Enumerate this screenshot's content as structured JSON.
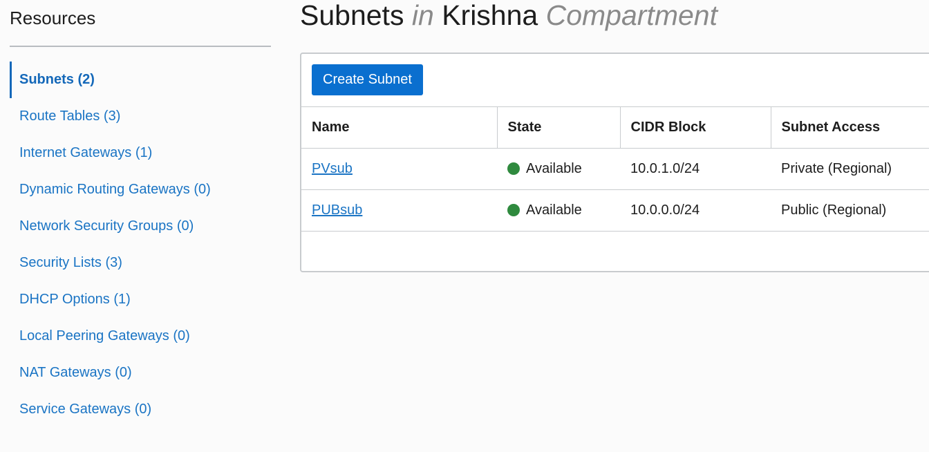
{
  "sidebar": {
    "title": "Resources",
    "items": [
      {
        "label": "Subnets (2)",
        "active": true
      },
      {
        "label": "Route Tables (3)"
      },
      {
        "label": "Internet Gateways (1)"
      },
      {
        "label": "Dynamic Routing Gateways (0)"
      },
      {
        "label": "Network Security Groups (0)"
      },
      {
        "label": "Security Lists (3)"
      },
      {
        "label": "DHCP Options (1)"
      },
      {
        "label": "Local Peering Gateways (0)"
      },
      {
        "label": "NAT Gateways (0)"
      },
      {
        "label": "Service Gateways (0)"
      }
    ]
  },
  "header": {
    "title_main": "Subnets",
    "title_in": "in",
    "compartment_name": "Krishna",
    "compartment_word": "Compartment"
  },
  "panel": {
    "create_label": "Create Subnet"
  },
  "table": {
    "columns": [
      "Name",
      "State",
      "CIDR Block",
      "Subnet Access"
    ],
    "rows": [
      {
        "name": "PVsub",
        "state": "Available",
        "cidr": "10.0.1.0/24",
        "access": "Private (Regional)"
      },
      {
        "name": "PUBsub",
        "state": "Available",
        "cidr": "10.0.0.0/24",
        "access": "Public (Regional)"
      }
    ]
  },
  "colors": {
    "accent": "#0a6fcf",
    "link": "#1a74c4",
    "status_available": "#2f8a3e"
  },
  "icons": {
    "state": "status-dot-icon"
  }
}
